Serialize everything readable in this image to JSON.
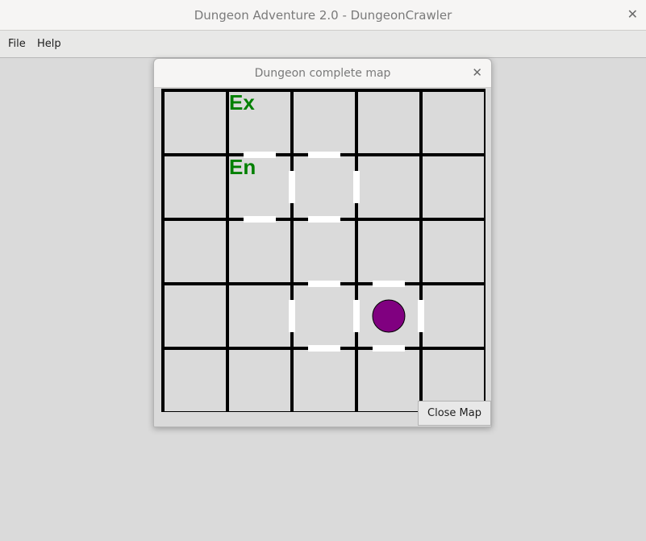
{
  "app": {
    "window_title": "Dungeon Adventure 2.0 - DungeonCrawler",
    "close_glyph": "✕"
  },
  "menubar": {
    "items": [
      {
        "label": "File"
      },
      {
        "label": "Help"
      }
    ]
  },
  "dialog": {
    "title": "Dungeon complete map",
    "close_glyph": "✕",
    "close_map_label": "Close Map"
  },
  "map": {
    "rows": 5,
    "cols": 5,
    "colors": {
      "background": "#dadada",
      "wall": "#000000",
      "door": "#ffffff",
      "marker_text": "#008000",
      "player": "#800080"
    },
    "markers": [
      {
        "label": "Ex",
        "row": 0,
        "col": 1,
        "meaning": "exit"
      },
      {
        "label": "En",
        "row": 1,
        "col": 1,
        "meaning": "entrance"
      }
    ],
    "player": {
      "row": 3,
      "col": 3,
      "icon": "player-token-icon"
    },
    "doors": [
      {
        "row": 1,
        "col": 1,
        "side": "top"
      },
      {
        "row": 1,
        "col": 1,
        "side": "bottom"
      },
      {
        "row": 1,
        "col": 2,
        "side": "top"
      },
      {
        "row": 1,
        "col": 2,
        "side": "left"
      },
      {
        "row": 1,
        "col": 2,
        "side": "right"
      },
      {
        "row": 1,
        "col": 2,
        "side": "bottom"
      },
      {
        "row": 3,
        "col": 2,
        "side": "top"
      },
      {
        "row": 3,
        "col": 2,
        "side": "left"
      },
      {
        "row": 3,
        "col": 2,
        "side": "right"
      },
      {
        "row": 3,
        "col": 2,
        "side": "bottom"
      },
      {
        "row": 3,
        "col": 3,
        "side": "top"
      },
      {
        "row": 3,
        "col": 3,
        "side": "right"
      },
      {
        "row": 3,
        "col": 3,
        "side": "bottom"
      }
    ]
  }
}
